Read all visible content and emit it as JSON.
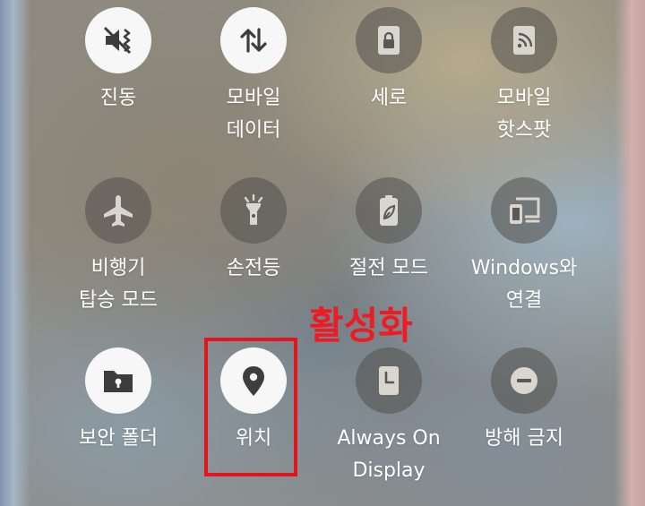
{
  "tiles": [
    {
      "name": "진동",
      "lines": [
        "진동",
        ""
      ],
      "icon": "vibrate-icon",
      "active": true
    },
    {
      "name": "모바일 데이터",
      "lines": [
        "모바일",
        "데이터"
      ],
      "icon": "mobile-data-icon",
      "active": true
    },
    {
      "name": "세로",
      "lines": [
        "세로",
        ""
      ],
      "icon": "portrait-lock-icon",
      "active": false
    },
    {
      "name": "모바일 핫스팟",
      "lines": [
        "모바일",
        "핫스팟"
      ],
      "icon": "hotspot-icon",
      "active": false
    },
    {
      "name": "비행기 탑승 모드",
      "lines": [
        "비행기",
        "탑승 모드"
      ],
      "icon": "airplane-icon",
      "active": false
    },
    {
      "name": "손전등",
      "lines": [
        "손전등",
        ""
      ],
      "icon": "flashlight-icon",
      "active": false
    },
    {
      "name": "절전 모드",
      "lines": [
        "절전 모드",
        ""
      ],
      "icon": "power-saving-icon",
      "active": false
    },
    {
      "name": "Windows와 연결",
      "lines": [
        "Windows와",
        "연결"
      ],
      "icon": "link-to-windows-icon",
      "active": false
    },
    {
      "name": "보안 폴더",
      "lines": [
        "보안 폴더",
        ""
      ],
      "icon": "secure-folder-icon",
      "active": true
    },
    {
      "name": "위치",
      "lines": [
        "위치",
        ""
      ],
      "icon": "location-pin-icon",
      "active": true
    },
    {
      "name": "Always On Display",
      "lines": [
        "Always On",
        "Display"
      ],
      "icon": "always-on-display-icon",
      "active": false
    },
    {
      "name": "방해 금지",
      "lines": [
        "방해 금지",
        ""
      ],
      "icon": "do-not-disturb-icon",
      "active": false
    }
  ],
  "annotation": {
    "text": "활성화",
    "color": "#ed1c24"
  },
  "colors": {
    "active_bg": "#f7f7f7",
    "active_icon": "#3d3d3d",
    "inactive_icon": "#d9d5cf"
  }
}
